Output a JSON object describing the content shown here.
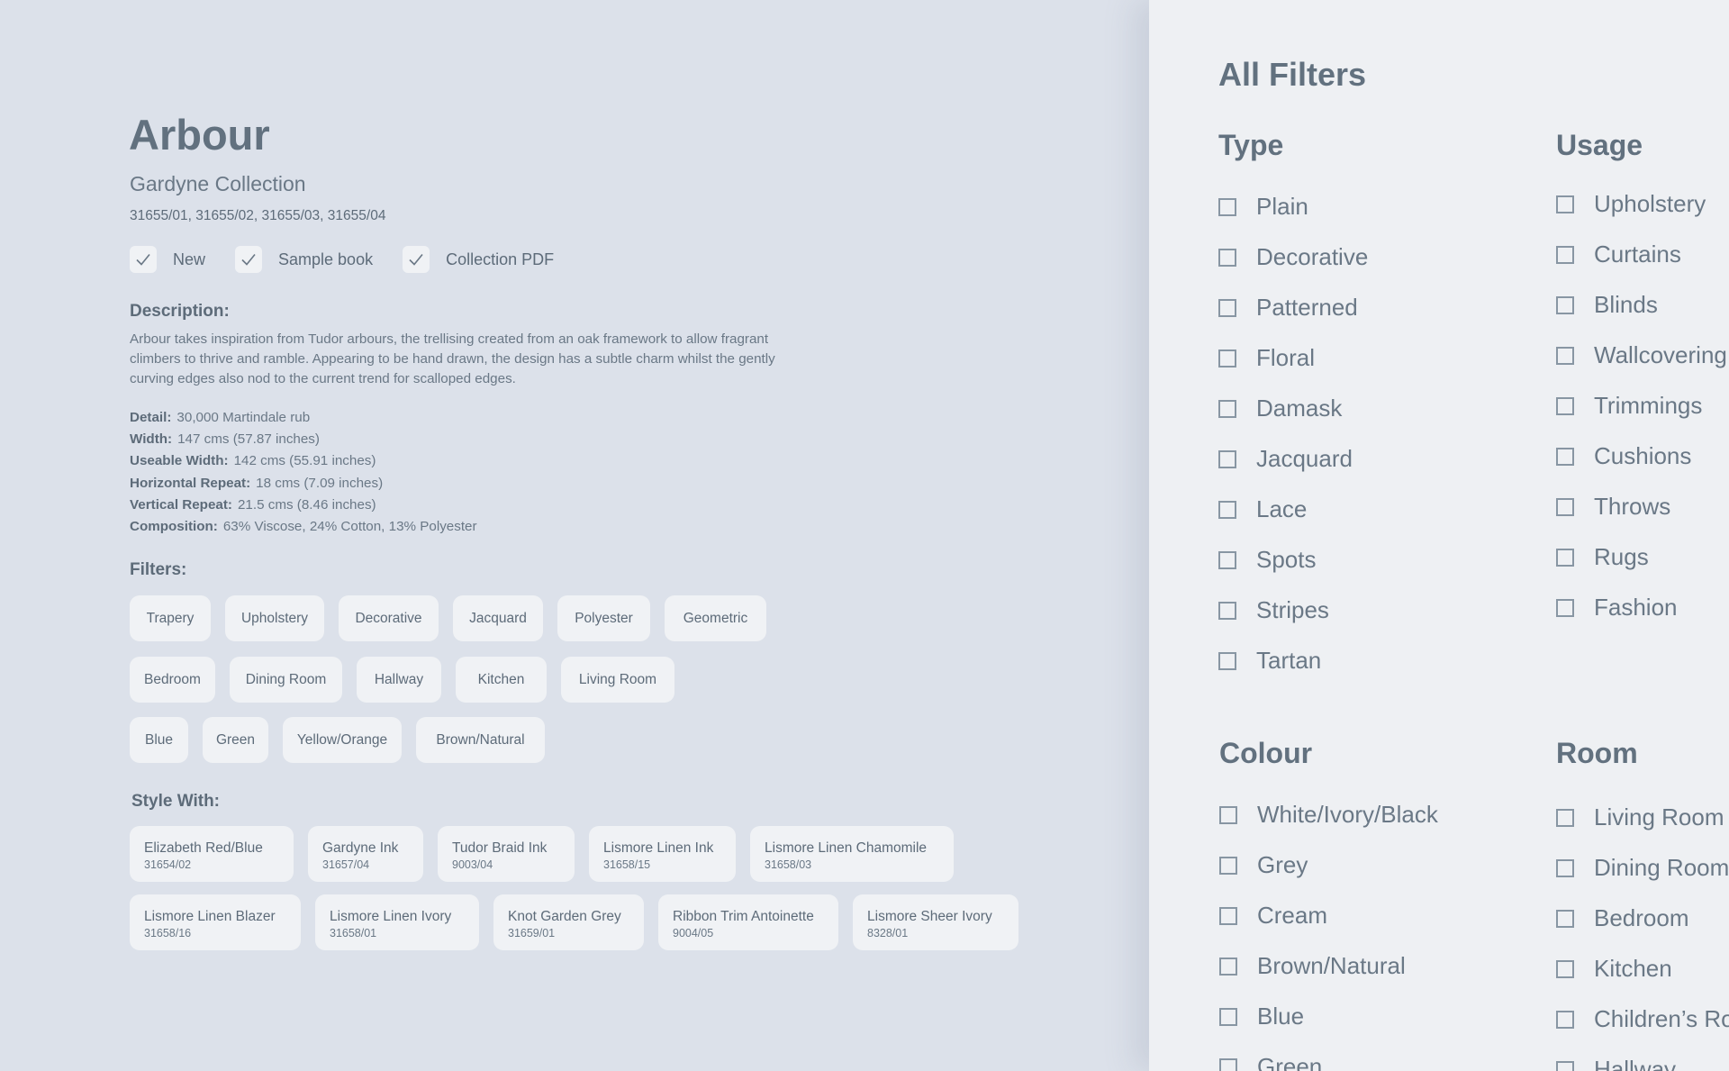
{
  "product": {
    "title": "Arbour",
    "collection": "Gardyne Collection",
    "codes": "31655/01, 31655/02, 31655/03, 31655/04",
    "flags": [
      "New",
      "Sample book",
      "Collection PDF"
    ],
    "description_heading": "Description:",
    "description": "Arbour takes inspiration from Tudor arbours, the trellising created from an oak framework to allow fragrant climbers to thrive and ramble. Appearing to be hand drawn, the design has a subtle charm whilst the gently curving edges also nod to the current trend for scalloped edges.",
    "specs": [
      {
        "label": "Detail:",
        "value": "30,000 Martindale rub"
      },
      {
        "label": "Width:",
        "value": "147 cms (57.87 inches)"
      },
      {
        "label": "Useable Width:",
        "value": "142 cms (55.91 inches)"
      },
      {
        "label": "Horizontal Repeat:",
        "value": "18 cms (7.09 inches)"
      },
      {
        "label": "Vertical Repeat:",
        "value": "21.5 cms (8.46 inches)"
      },
      {
        "label": "Composition:",
        "value": "63% Viscose, 24% Cotton, 13% Polyester"
      }
    ],
    "filters_heading": "Filters:",
    "filter_rows": [
      [
        "Trapery",
        "Upholstery",
        "Decorative",
        "Jacquard",
        "Polyester",
        "Geometric"
      ],
      [
        "Bedroom",
        "Dining Room",
        "Hallway",
        "Kitchen",
        "Living Room"
      ],
      [
        "Blue",
        "Green",
        "Yellow/Orange",
        "Brown/Natural"
      ]
    ],
    "style_heading": "Style With:",
    "style_rows": [
      [
        {
          "name": "Elizabeth Red/Blue",
          "code": "31654/02"
        },
        {
          "name": "Gardyne Ink",
          "code": "31657/04"
        },
        {
          "name": "Tudor Braid Ink",
          "code": "9003/04"
        },
        {
          "name": "Lismore Linen Ink",
          "code": "31658/15"
        },
        {
          "name": "Lismore Linen Chamomile",
          "code": "31658/03"
        }
      ],
      [
        {
          "name": "Lismore Linen Blazer",
          "code": "31658/16"
        },
        {
          "name": "Lismore Linen Ivory",
          "code": "31658/01"
        },
        {
          "name": "Knot Garden Grey",
          "code": "31659/01"
        },
        {
          "name": "Ribbon Trim Antoinette",
          "code": "9004/05"
        },
        {
          "name": "Lismore Sheer Ivory",
          "code": "8328/01"
        }
      ]
    ]
  },
  "panel": {
    "title": "All Filters",
    "groups": [
      {
        "heading": "Type",
        "options": [
          "Plain",
          "Decorative",
          "Patterned",
          "Floral",
          "Damask",
          "Jacquard",
          "Lace",
          "Spots",
          "Stripes",
          "Tartan"
        ]
      },
      {
        "heading": "Usage",
        "options": [
          "Upholstery",
          "Curtains",
          "Blinds",
          "Wallcovering",
          "Trimmings",
          "Cushions",
          "Throws",
          "Rugs",
          "Fashion"
        ]
      },
      {
        "heading": "Colour",
        "options": [
          "White/Ivory/Black",
          "Grey",
          "Cream",
          "Brown/Natural",
          "Blue",
          "Green"
        ]
      },
      {
        "heading": "Room",
        "options": [
          "Living Room",
          "Dining Room",
          "Bedroom",
          "Kitchen",
          "Children’s Room",
          "Hallway"
        ]
      }
    ]
  },
  "icons": {
    "flag_check": "checkmark-icon",
    "option_box": "checkbox-icon"
  }
}
